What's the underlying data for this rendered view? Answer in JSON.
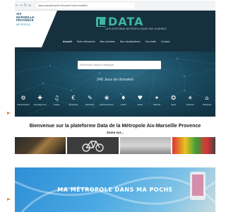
{
  "browser": {
    "url": "data.ampmetropole.fr/explore/?sort=modified",
    "icons": [
      "back-arrow-icon",
      "forward-arrow-icon",
      "reload-icon",
      "home-icon"
    ]
  },
  "header": {
    "logo_lines": [
      "AIX",
      "MARSEILLE",
      "PROVENCE"
    ],
    "logo_sub": "MÉTROPOLE",
    "brand_title": "DATA",
    "brand_tagline": "LA PLATEFORME METROPOLITAINE DES DONNÉES",
    "nav": [
      "Accueil",
      "Notre démarche",
      "Nos données",
      "Nos visualisations",
      "Vos outils",
      "Contact"
    ]
  },
  "hero": {
    "search_placeholder": "Rechercher dans le catalogue...",
    "datasets_count": "248 Jeux de données",
    "themes": [
      {
        "label": "Administration",
        "icon": "administration-icon",
        "glyph": "⚙"
      },
      {
        "label": "Aménagement",
        "icon": "planning-icon",
        "glyph": "✚"
      },
      {
        "label": "Culture",
        "icon": "culture-icon",
        "glyph": "♫"
      },
      {
        "label": "Économie",
        "icon": "economy-icon",
        "glyph": "€"
      },
      {
        "label": "Éducation",
        "icon": "education-icon",
        "glyph": "✎"
      },
      {
        "label": "Environnement",
        "icon": "environment-icon",
        "glyph": "❀"
      },
      {
        "label": "Loisirs",
        "icon": "leisure-icon",
        "glyph": "♦"
      },
      {
        "label": "Santé",
        "icon": "health-icon",
        "glyph": "♥"
      },
      {
        "label": "Sécurité",
        "icon": "security-icon",
        "glyph": "✦"
      },
      {
        "label": "Sport",
        "icon": "sport-icon",
        "glyph": "✪"
      },
      {
        "label": "Tourisme",
        "icon": "tourism-icon",
        "glyph": "☀"
      },
      {
        "label": "Transports",
        "icon": "transport-icon",
        "glyph": "⌂"
      }
    ]
  },
  "welcome": {
    "title": "Bienvenue sur la plateforme Data de la Métropole Aix-Marseille Provence",
    "zoom_label": "Zoom sur..."
  },
  "app_banner": {
    "text": "MA MÉTROPOLE DANS MA POCHE"
  },
  "colors": {
    "header_bg": "#16303f",
    "brand_accent": "#3bb6a4",
    "pointer_arrow": "#e78a2a"
  }
}
